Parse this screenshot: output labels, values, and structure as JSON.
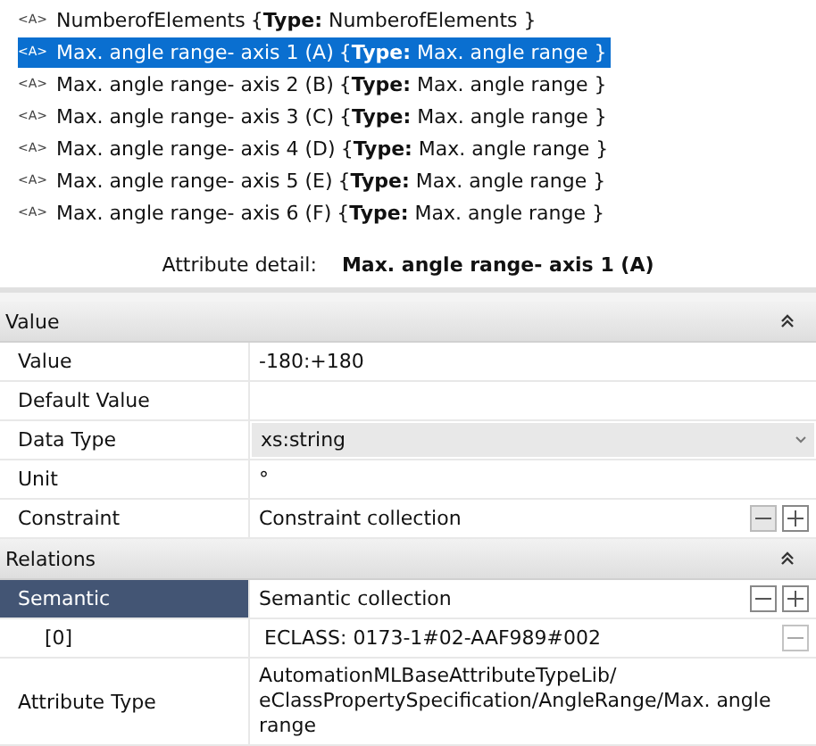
{
  "tree": {
    "items": [
      {
        "badge": "<A>",
        "name": "NumberofElements",
        "type_text": "{**Type:**  NumberofElements }",
        "selected": false
      },
      {
        "badge": "<A>",
        "name": "Max. angle range- axis 1 (A)",
        "type_text": "{**Type:**  Max. angle range }",
        "selected": true
      },
      {
        "badge": "<A>",
        "name": "Max. angle range- axis 2 (B)",
        "type_text": "{**Type:**  Max. angle range }",
        "selected": false
      },
      {
        "badge": "<A>",
        "name": "Max. angle range- axis 3 (C)",
        "type_text": "{**Type:**  Max. angle range }",
        "selected": false
      },
      {
        "badge": "<A>",
        "name": "Max. angle range- axis 4 (D)",
        "type_text": "{**Type:**  Max. angle range }",
        "selected": false
      },
      {
        "badge": "<A>",
        "name": "Max. angle range- axis 5 (E)",
        "type_text": "{**Type:**  Max. angle range }",
        "selected": false
      },
      {
        "badge": "<A>",
        "name": "Max. angle range- axis 6 (F)",
        "type_text": "{**Type:**  Max. angle range }",
        "selected": false
      }
    ]
  },
  "detail": {
    "label": "Attribute detail:",
    "value": "Max. angle range- axis 1 (A)"
  },
  "sections": [
    {
      "title": "Value",
      "expanded": true,
      "rows": [
        {
          "kind": "text",
          "label": "Value",
          "value": "-180:+180",
          "selected": false
        },
        {
          "kind": "text",
          "label": "Default Value",
          "selected": false
        },
        {
          "kind": "dropdown",
          "label": "Data Type",
          "value": "xs:string",
          "selected": false
        },
        {
          "kind": "text",
          "label": "Unit",
          "value": "°",
          "selected": false
        },
        {
          "kind": "collection",
          "label": "Constraint",
          "value": "Constraint collection",
          "selected": false
        }
      ]
    },
    {
      "title": "Relations",
      "expanded": true,
      "rows": [
        {
          "kind": "collection",
          "label": "Semantic",
          "value": "Semantic collection",
          "selected": true
        },
        {
          "kind": "item",
          "label": "[0]",
          "value": "ECLASS:  0173-1#02-AAF989#002",
          "selected": false
        },
        {
          "kind": "text",
          "label": "Attribute Type",
          "value": "AutomationMLBaseAttributeTypeLib/ eClassPropertySpecification/AngleRange/Max. angle range",
          "selected": false
        }
      ]
    }
  ]
}
